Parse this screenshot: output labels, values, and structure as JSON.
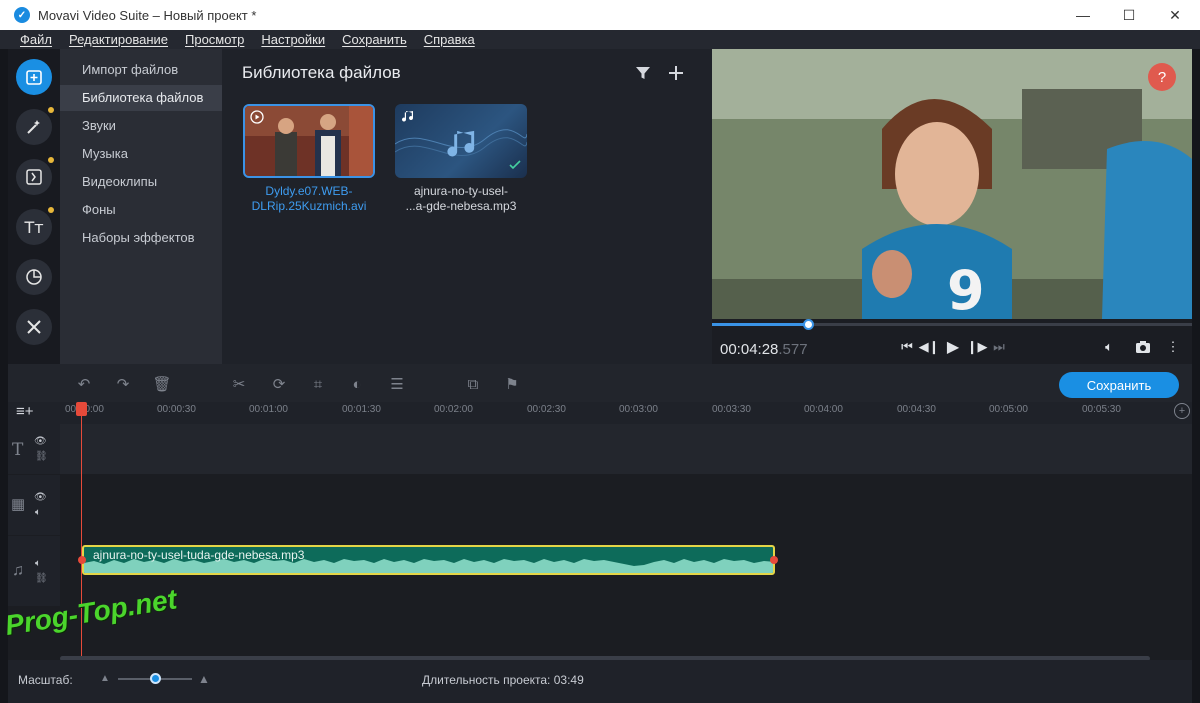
{
  "window": {
    "title": "Movavi Video Suite – Новый проект *",
    "minimize": "—",
    "maximize": "☐",
    "close": "✕"
  },
  "menu": [
    "Файл",
    "Редактирование",
    "Просмотр",
    "Настройки",
    "Сохранить",
    "Справка"
  ],
  "sidebar_tools": [
    {
      "icon": "import-icon",
      "active": true
    },
    {
      "icon": "magic-wand-icon",
      "badge": true
    },
    {
      "icon": "transitions-icon",
      "badge": true
    },
    {
      "icon": "titles-icon",
      "badge": true
    },
    {
      "icon": "stickers-icon"
    },
    {
      "icon": "tools-icon"
    }
  ],
  "categories": [
    "Импорт файлов",
    "Библиотека файлов",
    "Звуки",
    "Музыка",
    "Видеоклипы",
    "Фоны",
    "Наборы эффектов"
  ],
  "selected_category": "Библиотека файлов",
  "library": {
    "title": "Библиотека файлов",
    "files": [
      {
        "name_line1": "Dyldy.e07.WEB-",
        "name_line2": "DLRip.25Kuzmich.avi",
        "type": "video",
        "selected": true
      },
      {
        "name_line1": "ajnura-no-ty-usel-",
        "name_line2": "...a-gde-nebesa.mp3",
        "type": "audio",
        "selected": false
      }
    ]
  },
  "player": {
    "time_main": "00:04:28",
    "time_ms": ".577",
    "progress": 0.2,
    "help": "?"
  },
  "toolbar": {
    "save_label": "Сохранить"
  },
  "ruler_ticks": [
    "00:00:00",
    "00:00:30",
    "00:01:00",
    "00:01:30",
    "00:02:00",
    "00:02:30",
    "00:03:00",
    "00:03:30",
    "00:04:00",
    "00:04:30",
    "00:05:00",
    "00:05:30"
  ],
  "audio_clip": {
    "label": "ajnura-no-ty-usel-tuda-gde-nebesa.mp3"
  },
  "status": {
    "zoom_label": "Масштаб:",
    "zoom_level": 0.5,
    "duration_label": "Длительность проекта:",
    "duration_value": "03:49"
  },
  "watermark": "Prog-Top.net",
  "colors": {
    "accent": "#1a8fe3",
    "playhead": "#e64a3a",
    "clip_border": "#e4d547",
    "clip_fill": "#0d6b5a",
    "badge": "#e8b73a"
  }
}
